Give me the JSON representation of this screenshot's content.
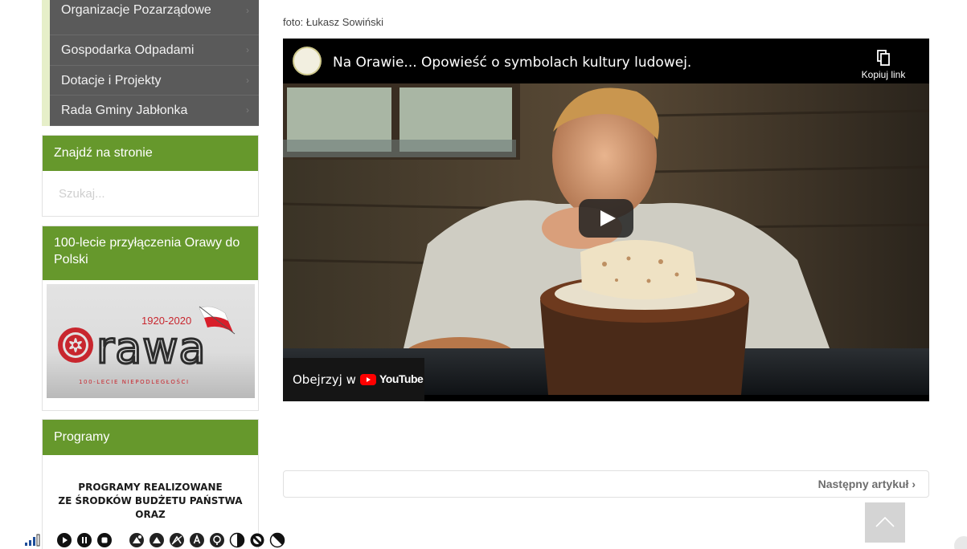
{
  "sidebar": {
    "menu_items": [
      {
        "label": "Organizacje Pozarządowe"
      },
      {
        "label": "Gospodarka Odpadami"
      },
      {
        "label": "Dotacje i Projekty"
      },
      {
        "label": "Rada Gminy Jabłonka"
      }
    ],
    "search_widget": {
      "title": "Znajdź na stronie",
      "placeholder": "Szukaj..."
    },
    "orawa_widget": {
      "title": "100-lecie przyłączenia Orawy do Polski",
      "years": "1920-2020",
      "logo_word": "Orawa",
      "tagline": "100-LECIE NIEPODLEGŁOŚCI"
    },
    "programs_widget": {
      "title": "Programy",
      "text_line1": "PROGRAMY REALIZOWANE",
      "text_line2": "ZE ŚRODKÓW BUDŻETU PAŃSTWA",
      "text_line3": "ORAZ"
    }
  },
  "main": {
    "photo_credit": "foto: Łukasz Sowiński",
    "video": {
      "title": "Na Orawie... Opowieść o symbolach kultury ludowej.",
      "copy_link_label": "Kopiuj link",
      "watch_on_label": "Obejrzyj w",
      "platform_label": "YouTube"
    },
    "next_article_label": "Następny artykuł"
  },
  "colors": {
    "accent_green": "#66982c",
    "menu_gray": "#5a5a5a",
    "youtube_red": "#ff0000"
  }
}
